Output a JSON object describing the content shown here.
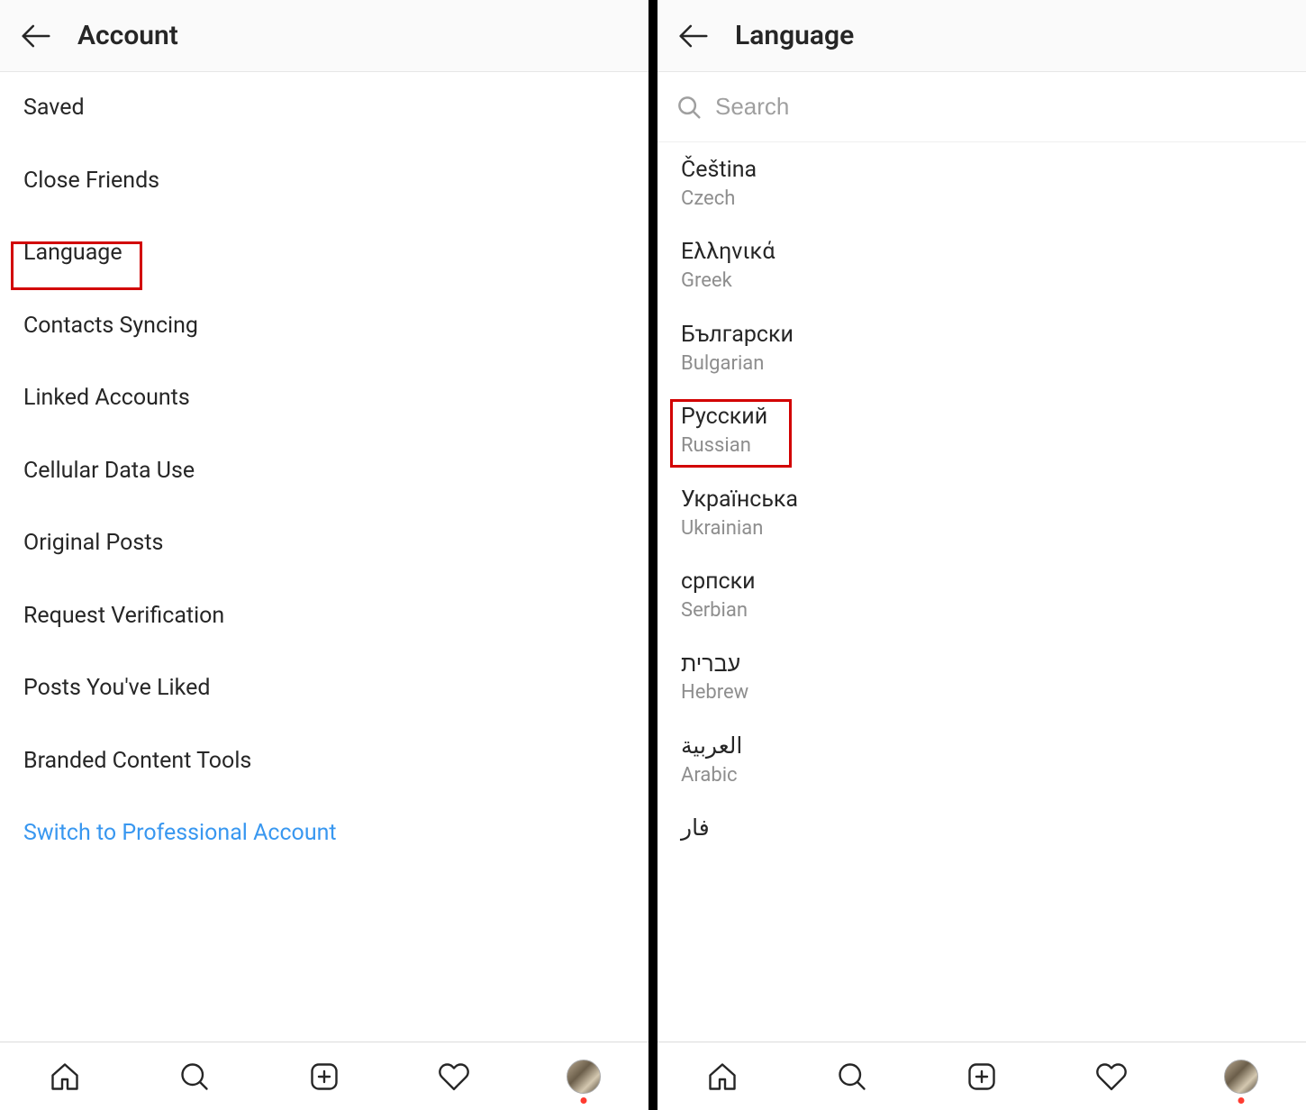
{
  "left": {
    "header_title": "Account",
    "items": [
      "Saved",
      "Close Friends",
      "Language",
      "Contacts Syncing",
      "Linked Accounts",
      "Cellular Data Use",
      "Original Posts",
      "Request Verification",
      "Posts You've Liked",
      "Branded Content Tools"
    ],
    "switch_link": "Switch to Professional Account",
    "highlighted_index": 2
  },
  "right": {
    "header_title": "Language",
    "search_placeholder": "Search",
    "languages": [
      {
        "native": "Čeština",
        "english": "Czech"
      },
      {
        "native": "Ελληνικά",
        "english": "Greek"
      },
      {
        "native": "Български",
        "english": "Bulgarian"
      },
      {
        "native": "Русский",
        "english": "Russian"
      },
      {
        "native": "Українська",
        "english": "Ukrainian"
      },
      {
        "native": "српски",
        "english": "Serbian"
      },
      {
        "native": "עברית",
        "english": "Hebrew"
      },
      {
        "native": "العربية",
        "english": "Arabic"
      }
    ],
    "partial_native": "فار",
    "highlighted_index": 3
  }
}
